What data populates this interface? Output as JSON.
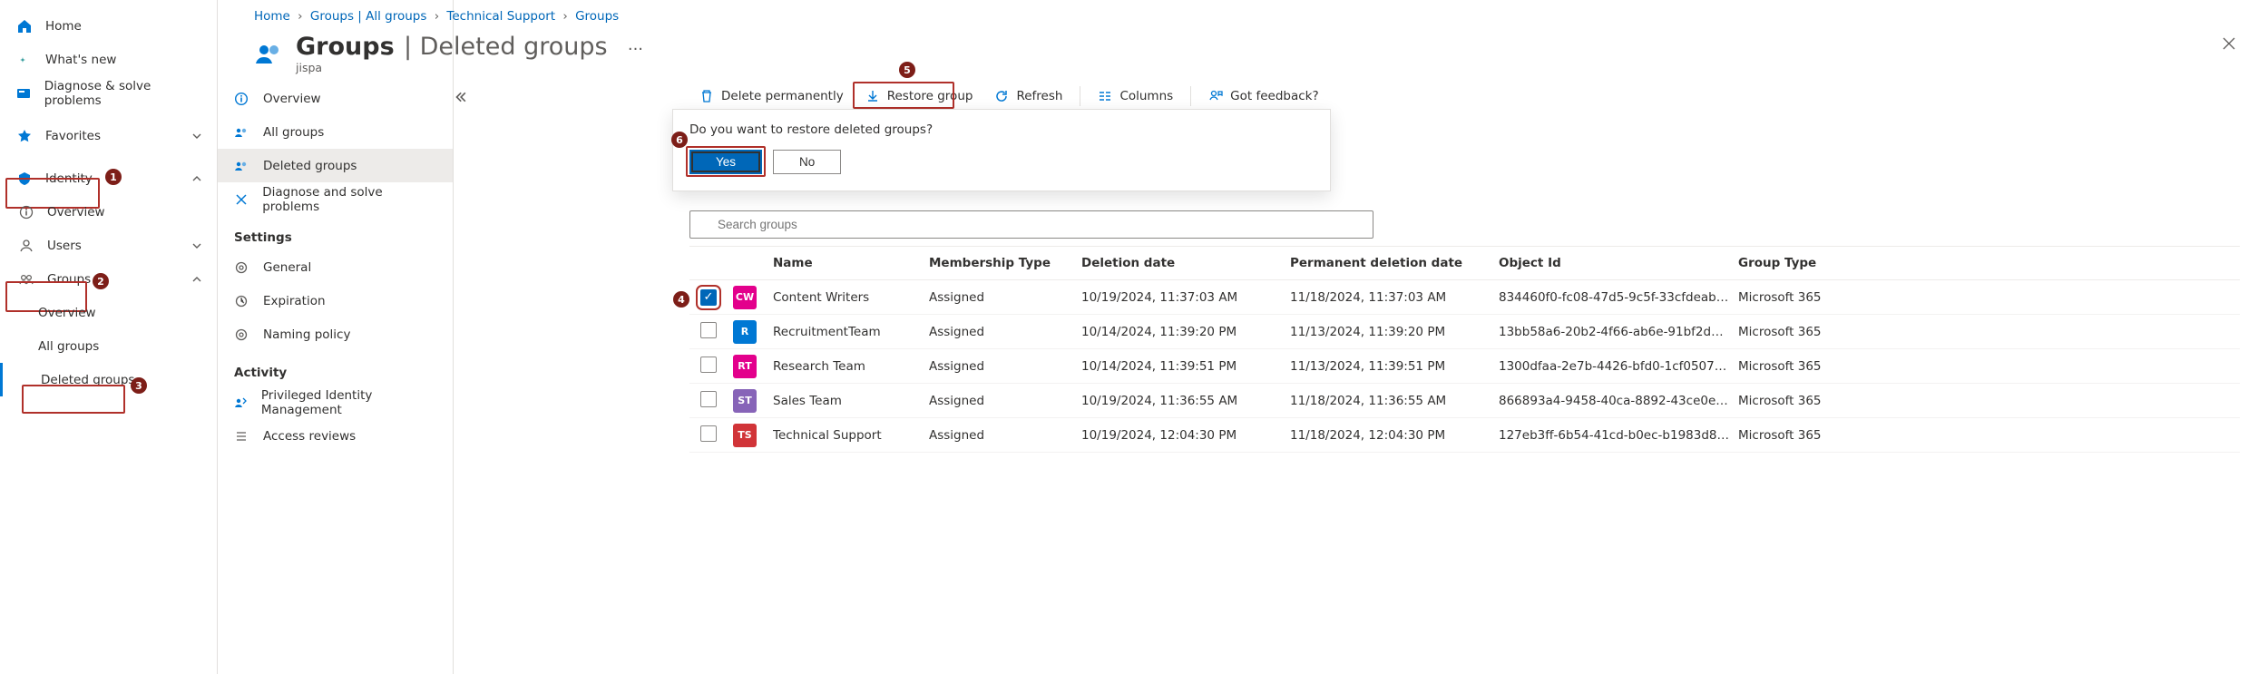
{
  "leftNav": {
    "home": "Home",
    "whatsnew": "What's new",
    "diagnose": "Diagnose & solve problems",
    "favorites": "Favorites",
    "identity": "Identity",
    "overview": "Overview",
    "users": "Users",
    "groups": "Groups",
    "groups_overview": "Overview",
    "groups_all": "All groups",
    "groups_deleted": "Deleted groups"
  },
  "breadcrumb": {
    "home": "Home",
    "groups_all": "Groups | All groups",
    "tech": "Technical Support",
    "groups": "Groups"
  },
  "header": {
    "title": "Groups",
    "subtitle": "| Deleted groups",
    "tenant": "jispa",
    "more": "···"
  },
  "midPane": {
    "overview": "Overview",
    "allgroups": "All groups",
    "deleted": "Deleted groups",
    "diagnose": "Diagnose and solve problems",
    "settings_head": "Settings",
    "general": "General",
    "expiration": "Expiration",
    "naming": "Naming policy",
    "activity_head": "Activity",
    "pim": "Privileged Identity Management",
    "access": "Access reviews"
  },
  "toolbar": {
    "delete": "Delete permanently",
    "restore": "Restore group",
    "refresh": "Refresh",
    "columns": "Columns",
    "feedback": "Got feedback?"
  },
  "popup": {
    "question": "Do you want to restore deleted groups?",
    "yes": "Yes",
    "no": "No"
  },
  "search": {
    "placeholder": "Search groups"
  },
  "table": {
    "headers": {
      "name": "Name",
      "membership": "Membership Type",
      "deletion": "Deletion date",
      "permanent": "Permanent deletion date",
      "objectid": "Object Id",
      "grouptype": "Group Type"
    },
    "rows": [
      {
        "checked": true,
        "initials": "CW",
        "color": "#e3008c",
        "name": "Content Writers",
        "membership": "Assigned",
        "deletion": "10/19/2024, 11:37:03 AM",
        "permanent": "11/18/2024, 11:37:03 AM",
        "objectid": "834460f0-fc08-47d5-9c5f-33cfdeab6…",
        "grouptype": "Microsoft 365"
      },
      {
        "checked": false,
        "initials": "R",
        "color": "#0078d4",
        "name": "RecruitmentTeam",
        "membership": "Assigned",
        "deletion": "10/14/2024, 11:39:20 PM",
        "permanent": "11/13/2024, 11:39:20 PM",
        "objectid": "13bb58a6-20b2-4f66-ab6e-91bf2d9…",
        "grouptype": "Microsoft 365"
      },
      {
        "checked": false,
        "initials": "RT",
        "color": "#e3008c",
        "name": "Research Team",
        "membership": "Assigned",
        "deletion": "10/14/2024, 11:39:51 PM",
        "permanent": "11/13/2024, 11:39:51 PM",
        "objectid": "1300dfaa-2e7b-4426-bfd0-1cf0507c…",
        "grouptype": "Microsoft 365"
      },
      {
        "checked": false,
        "initials": "ST",
        "color": "#8764b8",
        "name": "Sales Team",
        "membership": "Assigned",
        "deletion": "10/19/2024, 11:36:55 AM",
        "permanent": "11/18/2024, 11:36:55 AM",
        "objectid": "866893a4-9458-40ca-8892-43ce0eb…",
        "grouptype": "Microsoft 365"
      },
      {
        "checked": false,
        "initials": "TS",
        "color": "#d13438",
        "name": "Technical Support",
        "membership": "Assigned",
        "deletion": "10/19/2024, 12:04:30 PM",
        "permanent": "11/18/2024, 12:04:30 PM",
        "objectid": "127eb3ff-6b54-41cd-b0ec-b1983d83…",
        "grouptype": "Microsoft 365"
      }
    ]
  },
  "callouts": {
    "1": "1",
    "2": "2",
    "3": "3",
    "4": "4",
    "5": "5",
    "6": "6"
  }
}
